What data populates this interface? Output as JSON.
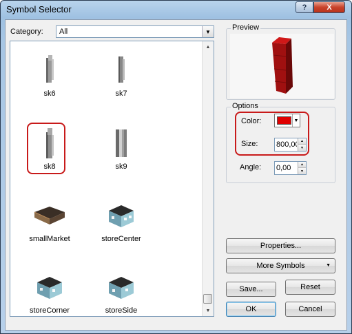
{
  "window": {
    "title": "Symbol Selector",
    "help_glyph": "?",
    "close_glyph": "X"
  },
  "category": {
    "label": "Category:",
    "value": "All"
  },
  "symbols": [
    {
      "name": "sk6"
    },
    {
      "name": "sk7"
    },
    {
      "name": "sk8"
    },
    {
      "name": "sk9"
    },
    {
      "name": "smallMarket"
    },
    {
      "name": "storeCenter"
    },
    {
      "name": "storeCorner"
    },
    {
      "name": "storeSide"
    }
  ],
  "preview": {
    "title": "Preview"
  },
  "options": {
    "title": "Options",
    "color_label": "Color:",
    "color_value": "#e00000",
    "size_label": "Size:",
    "size_value": "800,00",
    "angle_label": "Angle:",
    "angle_value": "0,00"
  },
  "buttons": {
    "properties": "Properties...",
    "more_symbols": "More Symbols",
    "save": "Save...",
    "reset": "Reset",
    "ok": "OK",
    "cancel": "Cancel"
  }
}
